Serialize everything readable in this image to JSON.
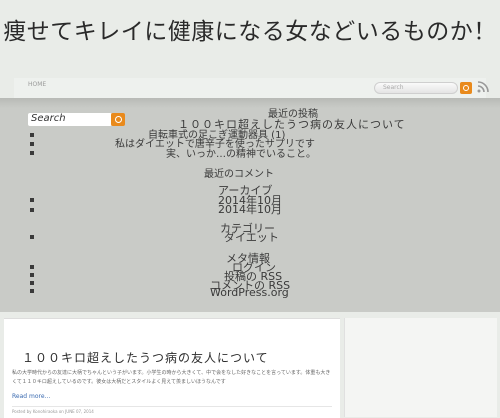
{
  "site": {
    "title": "痩せてキレイに健康になる女などいるものか！"
  },
  "header": {
    "nav_home": "HOME",
    "search_placeholder": "Search",
    "rss_icon": "rss-icon"
  },
  "sidebar": {
    "search_placeholder": "Search",
    "recent_posts_heading": "最近の投稿",
    "recent_posts": [
      "１００キロ超えしたうつ病の友人について",
      "自転車式の足こぎ運動器具 (1)",
      "私はダイエットで唐辛子を使ったサプリです",
      "実、いっか…の精神でいること。"
    ],
    "recent_comments_heading": "最近のコメント",
    "archives_heading": "アーカイブ",
    "archives": [
      "2014年10月",
      "2014年10月"
    ],
    "categories_heading": "カテゴリー",
    "categories": [
      "ダイエット"
    ],
    "meta_heading": "メタ情報",
    "meta": [
      "ログイン",
      "投稿の RSS",
      "コメントの RSS",
      "WordPress.org"
    ]
  },
  "post": {
    "title": "１００キロ超えしたうつ病の友人について",
    "excerpt": "私の大学時代からの友達に大柄でちゃんという子がいます。小学生の時から大きくて、中で会をなした好きなことを言っています。体重も大きくて１１０キロ超えしているのです。彼女は大柄だとスタイルよく見えて羨ましいほうなんです",
    "read_more": "Read more...",
    "meta": "Posted by Konohiraoka on JUNE 07, 2014"
  }
}
